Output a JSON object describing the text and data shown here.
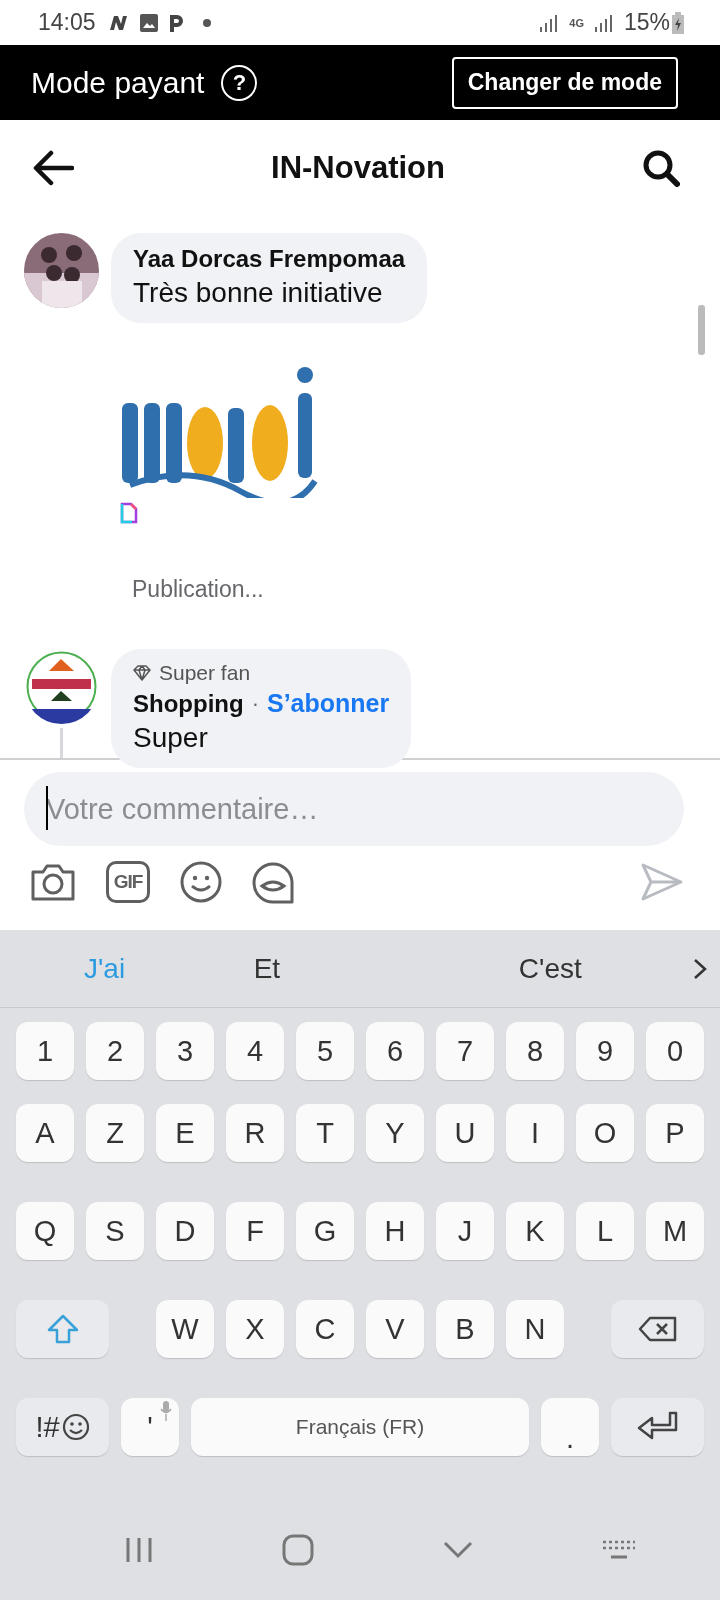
{
  "status_bar": {
    "time": "14:05",
    "network": "4G",
    "battery": "15%"
  },
  "mode_bar": {
    "title": "Mode payant",
    "help_glyph": "?",
    "button": "Changer de mode"
  },
  "header": {
    "title": "IN-Novation"
  },
  "comments": [
    {
      "kind": "text",
      "author": "Yaa Dorcas Frempomaa",
      "text": "Très bonne initiative"
    },
    {
      "kind": "sticker",
      "status": "Publication..."
    },
    {
      "kind": "fan",
      "badge": "Super fan",
      "author": "Shopping",
      "separator": "·",
      "action": "S’abonner",
      "text": "Super"
    }
  ],
  "composer": {
    "placeholder": "Votre commentaire…",
    "gif_label": "GIF",
    "send_disabled": true
  },
  "suggestions": [
    {
      "label": "J'ai",
      "selected": true
    },
    {
      "label": "Et",
      "selected": false
    },
    {
      "label": "C'est",
      "selected": false
    }
  ],
  "keyboard": [
    [
      {
        "kind": "char",
        "label": "1"
      },
      {
        "kind": "char",
        "label": "2"
      },
      {
        "kind": "char",
        "label": "3"
      },
      {
        "kind": "char",
        "label": "4"
      },
      {
        "kind": "char",
        "label": "5"
      },
      {
        "kind": "char",
        "label": "6"
      },
      {
        "kind": "char",
        "label": "7"
      },
      {
        "kind": "char",
        "label": "8"
      },
      {
        "kind": "char",
        "label": "9"
      },
      {
        "kind": "char",
        "label": "0"
      }
    ],
    [
      {
        "kind": "char",
        "label": "A"
      },
      {
        "kind": "char",
        "label": "Z"
      },
      {
        "kind": "char",
        "label": "E"
      },
      {
        "kind": "char",
        "label": "R"
      },
      {
        "kind": "char",
        "label": "T"
      },
      {
        "kind": "char",
        "label": "Y"
      },
      {
        "kind": "char",
        "label": "U"
      },
      {
        "kind": "char",
        "label": "I"
      },
      {
        "kind": "char",
        "label": "O"
      },
      {
        "kind": "char",
        "label": "P"
      }
    ],
    [
      {
        "kind": "char",
        "label": "Q"
      },
      {
        "kind": "char",
        "label": "S"
      },
      {
        "kind": "char",
        "label": "D"
      },
      {
        "kind": "char",
        "label": "F"
      },
      {
        "kind": "char",
        "label": "G"
      },
      {
        "kind": "char",
        "label": "H"
      },
      {
        "kind": "char",
        "label": "J"
      },
      {
        "kind": "char",
        "label": "K"
      },
      {
        "kind": "char",
        "label": "L"
      },
      {
        "kind": "char",
        "label": "M"
      }
    ],
    [
      {
        "kind": "shift"
      },
      {
        "kind": "char",
        "label": "W"
      },
      {
        "kind": "char",
        "label": "X"
      },
      {
        "kind": "char",
        "label": "C"
      },
      {
        "kind": "char",
        "label": "V"
      },
      {
        "kind": "char",
        "label": "B"
      },
      {
        "kind": "char",
        "label": "N"
      },
      {
        "kind": "backspace"
      }
    ],
    [
      {
        "kind": "symbols",
        "label": "!#"
      },
      {
        "kind": "apostrophe",
        "label": "'"
      },
      {
        "kind": "space",
        "label": "Français (FR)"
      },
      {
        "kind": "period",
        "label": "."
      },
      {
        "kind": "enter"
      }
    ]
  ]
}
